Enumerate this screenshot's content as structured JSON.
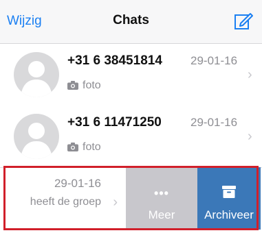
{
  "navbar": {
    "edit_label": "Wijzig",
    "title": "Chats",
    "compose_icon": "compose-icon"
  },
  "chats": [
    {
      "name": "+31 6 38451814",
      "date": "29-01-16",
      "preview": "foto",
      "preview_icon": "camera-icon"
    },
    {
      "name": "+31 6 11471250",
      "date": "29-01-16",
      "preview": "foto",
      "preview_icon": "camera-icon"
    }
  ],
  "swiped_chat": {
    "date": "29-01-16",
    "preview": "heeft de groep",
    "actions": {
      "more_label": "Meer",
      "archive_label": "Archiveer"
    }
  },
  "colors": {
    "accent": "#1a7ff2",
    "archive": "#3b78b8",
    "more": "#c8c7cc",
    "highlight": "#d11f2a"
  }
}
